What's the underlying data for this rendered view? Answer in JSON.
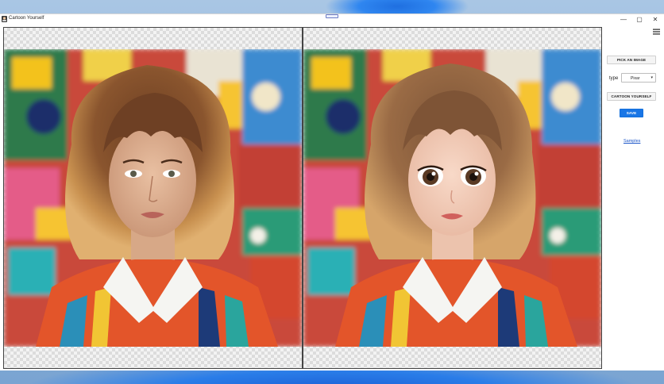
{
  "window": {
    "title": "Cartoon Yourself",
    "controls": {
      "minimize": "—",
      "maximize": "▢",
      "close": "✕"
    }
  },
  "panel": {
    "pick_image_label": "PICK AN IMAGE",
    "type_label": "type",
    "type_value": "Pixar",
    "cartoon_label": "CARTOON YOURSELF",
    "save_label": "SAVE",
    "samples_link": "Samples"
  },
  "colors": {
    "accent": "#1976e6",
    "link": "#1a55c8"
  },
  "icons": [
    "app-icon",
    "grip-icon",
    "hamburger-menu-icon",
    "chevron-down-icon"
  ]
}
